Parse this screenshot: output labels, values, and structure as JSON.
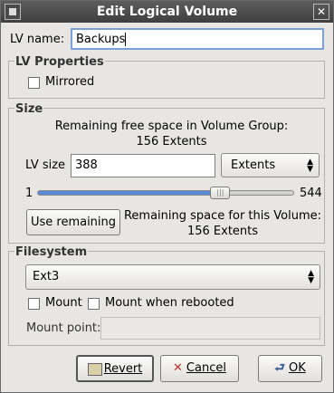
{
  "window": {
    "title": "Edit Logical Volume",
    "close_glyph": "✕"
  },
  "lv_name": {
    "label": "LV name:",
    "value": "Backups"
  },
  "lv_properties": {
    "title": "LV Properties",
    "mirrored_label": "Mirrored",
    "mirrored_checked": false
  },
  "size": {
    "title": "Size",
    "remaining_line1": "Remaining free space in Volume Group:",
    "remaining_line2": "156 Extents",
    "lv_size_label": "LV size",
    "lv_size_value": "388",
    "unit_selected": "Extents",
    "slider_min": "1",
    "slider_max": "544",
    "slider_value": 388,
    "use_remaining_label": "Use remaining",
    "vol_remaining_line1": "Remaining space for this Volume:",
    "vol_remaining_line2": "156 Extents"
  },
  "filesystem": {
    "title": "Filesystem",
    "selected": "Ext3",
    "mount_label": "Mount",
    "mount_checked": false,
    "mount_reboot_label": "Mount when rebooted",
    "mount_reboot_checked": false,
    "mount_point_label": "Mount point:",
    "mount_point_value": ""
  },
  "buttons": {
    "revert": "Revert",
    "cancel": "Cancel",
    "ok": "OK"
  },
  "colors": {
    "titlebar": "#4a4a4a",
    "slider_fill": "#5a8cd6",
    "window_bg": "#e8e6e3"
  }
}
